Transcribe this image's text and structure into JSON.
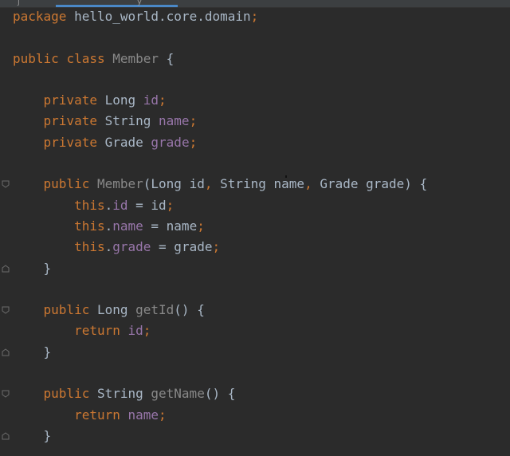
{
  "editor": {
    "tabs": [
      {
        "label": "j"
      },
      {
        "label": "y"
      }
    ],
    "code_lines": [
      [
        {
          "t": "package",
          "c": "kw"
        },
        {
          "t": " hello_world.core.domain",
          "c": "id"
        },
        {
          "t": ";",
          "c": "punct"
        }
      ],
      [],
      [
        {
          "t": "public",
          "c": "kw"
        },
        {
          "t": " ",
          "c": "id"
        },
        {
          "t": "class",
          "c": "kw"
        },
        {
          "t": " ",
          "c": "id"
        },
        {
          "t": "Member",
          "c": "muted"
        },
        {
          "t": " {",
          "c": "id"
        }
      ],
      [],
      [
        {
          "t": "    private",
          "c": "kw"
        },
        {
          "t": " Long ",
          "c": "id"
        },
        {
          "t": "id",
          "c": "field"
        },
        {
          "t": ";",
          "c": "punct"
        }
      ],
      [
        {
          "t": "    private",
          "c": "kw"
        },
        {
          "t": " String ",
          "c": "id"
        },
        {
          "t": "name",
          "c": "field"
        },
        {
          "t": ";",
          "c": "punct"
        }
      ],
      [
        {
          "t": "    private",
          "c": "kw"
        },
        {
          "t": " Grade ",
          "c": "id"
        },
        {
          "t": "grade",
          "c": "field"
        },
        {
          "t": ";",
          "c": "punct"
        }
      ],
      [],
      [
        {
          "t": "    public",
          "c": "kw"
        },
        {
          "t": " ",
          "c": "id"
        },
        {
          "t": "Member",
          "c": "muted"
        },
        {
          "t": "(Long id",
          "c": "id"
        },
        {
          "t": ",",
          "c": "punct"
        },
        {
          "t": " String name",
          "c": "id"
        },
        {
          "t": ",",
          "c": "punct"
        },
        {
          "t": " Grade grade) {",
          "c": "id"
        }
      ],
      [
        {
          "t": "        this",
          "c": "kw"
        },
        {
          "t": ".",
          "c": "id"
        },
        {
          "t": "id",
          "c": "field"
        },
        {
          "t": " = id",
          "c": "id"
        },
        {
          "t": ";",
          "c": "punct"
        }
      ],
      [
        {
          "t": "        this",
          "c": "kw"
        },
        {
          "t": ".",
          "c": "id"
        },
        {
          "t": "name",
          "c": "field"
        },
        {
          "t": " = name",
          "c": "id"
        },
        {
          "t": ";",
          "c": "punct"
        }
      ],
      [
        {
          "t": "        this",
          "c": "kw"
        },
        {
          "t": ".",
          "c": "id"
        },
        {
          "t": "grade",
          "c": "field"
        },
        {
          "t": " = grade",
          "c": "id"
        },
        {
          "t": ";",
          "c": "punct"
        }
      ],
      [
        {
          "t": "    }",
          "c": "id"
        }
      ],
      [],
      [
        {
          "t": "    public",
          "c": "kw"
        },
        {
          "t": " Long ",
          "c": "id"
        },
        {
          "t": "getId",
          "c": "muted"
        },
        {
          "t": "() {",
          "c": "id"
        }
      ],
      [
        {
          "t": "        return",
          "c": "kw"
        },
        {
          "t": " ",
          "c": "id"
        },
        {
          "t": "id",
          "c": "field"
        },
        {
          "t": ";",
          "c": "punct"
        }
      ],
      [
        {
          "t": "    }",
          "c": "id"
        }
      ],
      [],
      [
        {
          "t": "    public",
          "c": "kw"
        },
        {
          "t": " String ",
          "c": "id"
        },
        {
          "t": "getName",
          "c": "muted"
        },
        {
          "t": "() {",
          "c": "id"
        }
      ],
      [
        {
          "t": "        return",
          "c": "kw"
        },
        {
          "t": " ",
          "c": "id"
        },
        {
          "t": "name",
          "c": "field"
        },
        {
          "t": ";",
          "c": "punct"
        }
      ],
      [
        {
          "t": "    }",
          "c": "id"
        }
      ]
    ],
    "fold_markers": [
      {
        "line": 8,
        "kind": "open"
      },
      {
        "line": 12,
        "kind": "close"
      },
      {
        "line": 14,
        "kind": "open"
      },
      {
        "line": 16,
        "kind": "close"
      },
      {
        "line": 18,
        "kind": "open"
      },
      {
        "line": 20,
        "kind": "close"
      }
    ]
  },
  "colors": {
    "background": "#2b2b2b",
    "keyword": "#cc7832",
    "identifier": "#a9b7c6",
    "field": "#9876aa",
    "method_name": "#888888",
    "tab_indicator": "#4a88c7"
  },
  "icons": {
    "fold_open": "fold-open-icon",
    "fold_close": "fold-close-icon"
  }
}
